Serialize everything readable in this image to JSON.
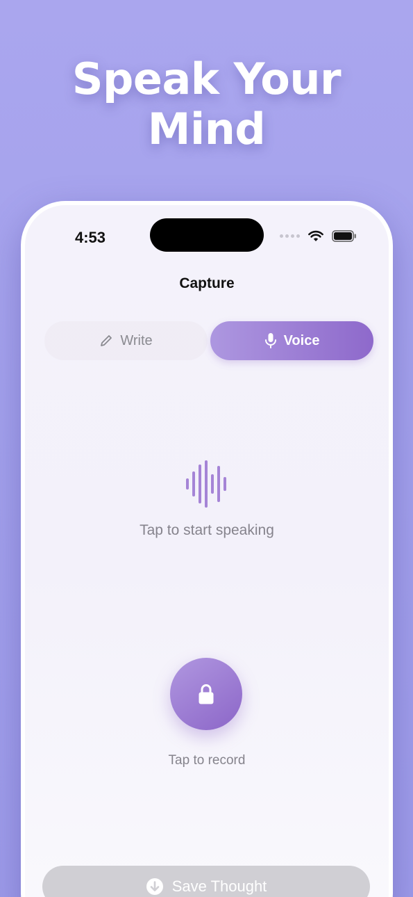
{
  "hero": {
    "line1": "Speak Your",
    "line2": "Mind"
  },
  "status": {
    "time": "4:53"
  },
  "nav": {
    "title": "Capture"
  },
  "segments": {
    "write_label": "Write",
    "voice_label": "Voice",
    "selected": "Voice"
  },
  "voice": {
    "hint": "Tap to start speaking",
    "record_label": "Tap to record"
  },
  "footer": {
    "save_label": "Save Thought"
  },
  "icons": {
    "pencil": "pencil-icon",
    "mic": "microphone-icon",
    "waveform": "waveform-icon",
    "lock": "lock-icon",
    "save": "arrow-down-circle-icon",
    "wifi": "wifi-icon",
    "battery": "battery-icon"
  },
  "colors": {
    "accent_start": "#ad97e0",
    "accent_end": "#8e69cb",
    "background": "#a3a1ec",
    "disabled": "#d0cfd4"
  }
}
